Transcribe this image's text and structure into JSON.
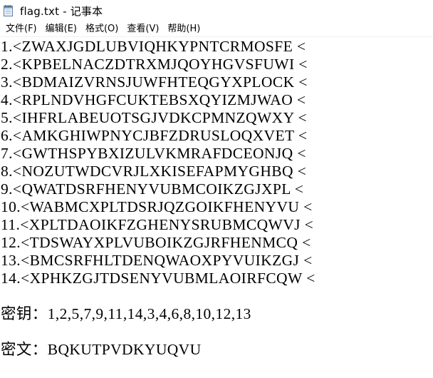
{
  "window": {
    "title": "flag.txt - 记事本"
  },
  "menu": {
    "items": [
      {
        "label": "文件(F)",
        "name": "menu-file"
      },
      {
        "label": "编辑(E)",
        "name": "menu-edit"
      },
      {
        "label": "格式(O)",
        "name": "menu-format"
      },
      {
        "label": "查看(V)",
        "name": "menu-view"
      },
      {
        "label": "帮助(H)",
        "name": "menu-help"
      }
    ]
  },
  "document": {
    "lines": [
      "1.<ZWAXJGDLUBVIQHKYPNTCRMOSFE <",
      "2.<KPBELNACZDTRXMJQOYHGVSFUWI <",
      "3.<BDMAIZVRNSJUWFHTEQGYXPLOCK <",
      "4.<RPLNDVHGFCUKTEBSXQYIZMJWAO <",
      "5.<IHFRLABEUOTSGJVDKCPMNZQWXY <",
      "6.<AMKGHIWPNYCJBFZDRUSLOQXVET <",
      "7.<GWTHSPYBXIZULVKMRAFDCEONJQ <",
      "8.<NOZUTWDCVRJLXKISEFAPMYGHBQ <",
      "9.<QWATDSRFHENYVUBMCOIKZGJXPL <",
      "10.<WABMCXPLTDSRJQZGOIKFHENYVU <",
      "11.<XPLTDAOIKFZGHENYSRUBMCQWVJ <",
      "12.<TDSWAYXPLVUBOIKZGJRFHENMCQ <",
      "13.<BMCSRFHLTDENQWAOXPYVUIKZGJ <",
      "14.<XPHKZGJTDSENYVUBMLAOIRFCQW <"
    ],
    "key_line": "密钥：1,2,5,7,9,11,14,3,4,6,8,10,12,13",
    "cipher_line": "密文：BQKUTPVDKYUQVU"
  }
}
